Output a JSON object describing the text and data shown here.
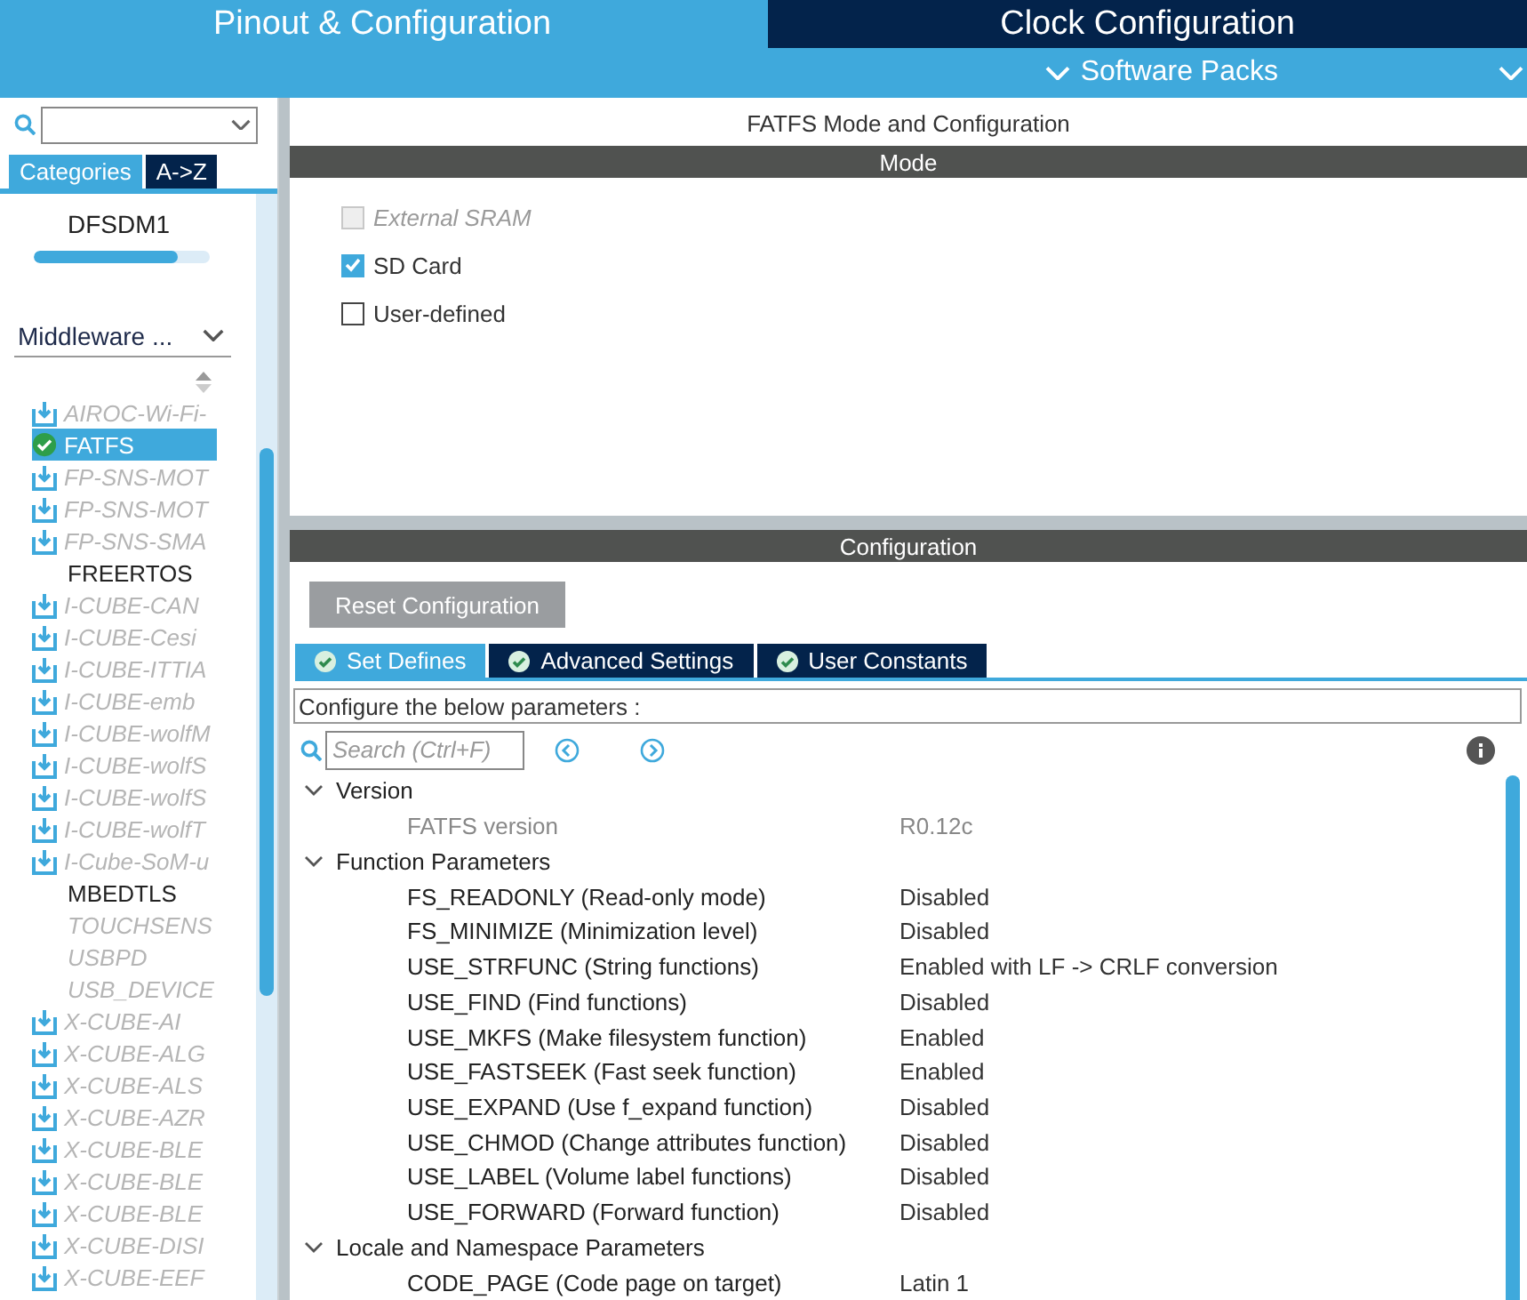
{
  "top_tabs": [
    {
      "label": "Pinout & Configuration",
      "selected": true
    },
    {
      "label": "Clock Configuration",
      "selected": false
    }
  ],
  "software_packs": {
    "label": "Software Packs"
  },
  "sidebar": {
    "tabs": [
      {
        "label": "Categories",
        "selected": true
      },
      {
        "label": "A->Z",
        "selected": false
      }
    ],
    "previous_item": "DFSDM1",
    "progress": {
      "level": 0.82
    },
    "category": "Middleware ...",
    "items": [
      {
        "label": "AIROC-Wi-Fi-",
        "kind": "pack",
        "enabled": false,
        "selected": false
      },
      {
        "label": "FATFS",
        "kind": "configured",
        "enabled": true,
        "selected": true
      },
      {
        "label": "FP-SNS-MOT",
        "kind": "pack",
        "enabled": false,
        "selected": false
      },
      {
        "label": "FP-SNS-MOT",
        "kind": "pack",
        "enabled": false,
        "selected": false
      },
      {
        "label": "FP-SNS-SMA",
        "kind": "pack",
        "enabled": false,
        "selected": false
      },
      {
        "label": "FREERTOS",
        "kind": "plain",
        "enabled": true,
        "selected": false
      },
      {
        "label": "I-CUBE-CAN",
        "kind": "pack",
        "enabled": false,
        "selected": false
      },
      {
        "label": "I-CUBE-Cesi",
        "kind": "pack",
        "enabled": false,
        "selected": false
      },
      {
        "label": "I-CUBE-ITTIA",
        "kind": "pack",
        "enabled": false,
        "selected": false
      },
      {
        "label": "I-CUBE-emb",
        "kind": "pack",
        "enabled": false,
        "selected": false
      },
      {
        "label": "I-CUBE-wolfM",
        "kind": "pack",
        "enabled": false,
        "selected": false
      },
      {
        "label": "I-CUBE-wolfS",
        "kind": "pack",
        "enabled": false,
        "selected": false
      },
      {
        "label": "I-CUBE-wolfS",
        "kind": "pack",
        "enabled": false,
        "selected": false
      },
      {
        "label": "I-CUBE-wolfT",
        "kind": "pack",
        "enabled": false,
        "selected": false
      },
      {
        "label": "I-Cube-SoM-u",
        "kind": "pack",
        "enabled": false,
        "selected": false
      },
      {
        "label": "MBEDTLS",
        "kind": "plain",
        "enabled": true,
        "selected": false
      },
      {
        "label": "TOUCHSENS",
        "kind": "plain",
        "enabled": false,
        "selected": false
      },
      {
        "label": "USBPD",
        "kind": "plain",
        "enabled": false,
        "selected": false
      },
      {
        "label": "USB_DEVICE",
        "kind": "plain",
        "enabled": false,
        "selected": false
      },
      {
        "label": "X-CUBE-AI",
        "kind": "pack",
        "enabled": false,
        "selected": false
      },
      {
        "label": "X-CUBE-ALG",
        "kind": "pack",
        "enabled": false,
        "selected": false
      },
      {
        "label": "X-CUBE-ALS",
        "kind": "pack",
        "enabled": false,
        "selected": false
      },
      {
        "label": "X-CUBE-AZR",
        "kind": "pack",
        "enabled": false,
        "selected": false
      },
      {
        "label": "X-CUBE-BLE",
        "kind": "pack",
        "enabled": false,
        "selected": false
      },
      {
        "label": "X-CUBE-BLE",
        "kind": "pack",
        "enabled": false,
        "selected": false
      },
      {
        "label": "X-CUBE-BLE",
        "kind": "pack",
        "enabled": false,
        "selected": false
      },
      {
        "label": "X-CUBE-DISI",
        "kind": "pack",
        "enabled": false,
        "selected": false
      },
      {
        "label": "X-CUBE-EEF",
        "kind": "pack",
        "enabled": false,
        "selected": false
      }
    ]
  },
  "main": {
    "title": "FATFS Mode and Configuration",
    "mode": {
      "title": "Mode",
      "options": [
        {
          "label": "External SRAM",
          "checked": false,
          "disabled": true
        },
        {
          "label": "SD Card",
          "checked": true,
          "disabled": false
        },
        {
          "label": "User-defined",
          "checked": false,
          "disabled": false
        }
      ]
    },
    "configuration": {
      "title": "Configuration",
      "reset_button": "Reset Configuration",
      "tabs": [
        {
          "label": "Set Defines",
          "selected": true
        },
        {
          "label": "Advanced Settings",
          "selected": false
        },
        {
          "label": "User Constants",
          "selected": false
        }
      ],
      "hint": "Configure the below parameters :",
      "search": {
        "placeholder": "Search (Ctrl+F)"
      },
      "groups": [
        {
          "label": "Version",
          "expanded": true,
          "children": [
            {
              "name": "FATFS version",
              "value": "R0.12c",
              "disabled": true
            }
          ]
        },
        {
          "label": "Function Parameters",
          "expanded": true,
          "children": [
            {
              "name": "FS_READONLY (Read-only mode)",
              "value": "Disabled",
              "disabled": false
            },
            {
              "name": "FS_MINIMIZE (Minimization level)",
              "value": "Disabled",
              "disabled": false
            },
            {
              "name": "USE_STRFUNC (String functions)",
              "value": "Enabled with LF -> CRLF conversion",
              "disabled": false
            },
            {
              "name": "USE_FIND (Find functions)",
              "value": "Disabled",
              "disabled": false
            },
            {
              "name": "USE_MKFS (Make filesystem function)",
              "value": "Enabled",
              "disabled": false
            },
            {
              "name": "USE_FASTSEEK (Fast seek function)",
              "value": "Enabled",
              "disabled": false
            },
            {
              "name": "USE_EXPAND (Use f_expand function)",
              "value": "Disabled",
              "disabled": false
            },
            {
              "name": "USE_CHMOD (Change attributes function)",
              "value": "Disabled",
              "disabled": false
            },
            {
              "name": "USE_LABEL (Volume label functions)",
              "value": "Disabled",
              "disabled": false
            },
            {
              "name": "USE_FORWARD (Forward function)",
              "value": "Disabled",
              "disabled": false
            }
          ]
        },
        {
          "label": "Locale and Namespace Parameters",
          "expanded": true,
          "children": [
            {
              "name": "CODE_PAGE (Code page on target)",
              "value": "Latin 1",
              "disabled": false
            }
          ]
        }
      ]
    }
  }
}
